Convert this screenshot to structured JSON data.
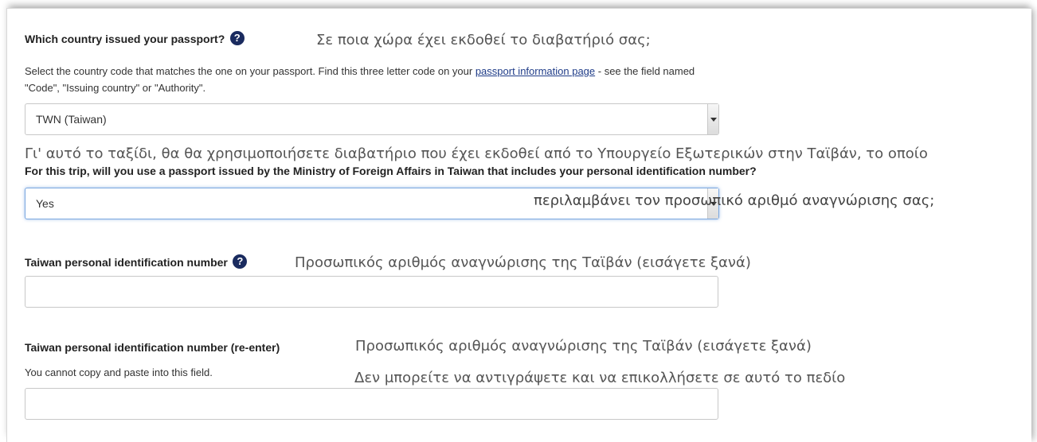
{
  "passport_country": {
    "label": "Which country issued your passport?",
    "overlay": "Σε ποια χώρα έχει εκδοθεί το διαβατήριό σας;",
    "help_line1_before_link": "Select the country code that matches the one on your passport.  Find this three letter code on your ",
    "help_link": "passport information page",
    "help_line1_after_link": " - see the field named",
    "help_line2": "\"Code\", \"Issuing country\" or \"Authority\".",
    "selected_value": "TWN (Taiwan)"
  },
  "mofa_passport": {
    "overlay_line1": "Γι' αυτό το ταξίδι, θα θα χρησιμοποιήσετε διαβατήριο που έχει εκδοθεί  από το Υπουργείο Εξωτερικών στην Ταϊβάν, το οποίο",
    "label": "For this trip, will you use a passport issued by the Ministry of Foreign Affairs in Taiwan that includes your personal identification number?",
    "selected_value": "Yes",
    "overlay_line2": "περιλαμβάνει τον προσωπικό αριθμό αναγνώρισης σας;"
  },
  "taiwan_id": {
    "label": "Taiwan personal identification number",
    "overlay": "Προσωπικός αριθμός αναγνώρισης της Ταϊβάν (εισάγετε ξανά)",
    "value": ""
  },
  "taiwan_id_reenter": {
    "label": "Taiwan personal identification number (re-enter)",
    "overlay": "Προσωπικός αριθμός αναγνώρισης της Ταϊβάν (εισάγετε ξανά)",
    "help": "You cannot copy and paste into this field.",
    "help_overlay": "Δεν μπορείτε να αντιγράψετε και να επικολλήσετε σε αυτό το πεδίο",
    "value": ""
  },
  "icons": {
    "help": "?"
  },
  "colors": {
    "help_icon": "#1a2b5f",
    "link": "#1f3c88",
    "focus": "#7aa7e0"
  }
}
